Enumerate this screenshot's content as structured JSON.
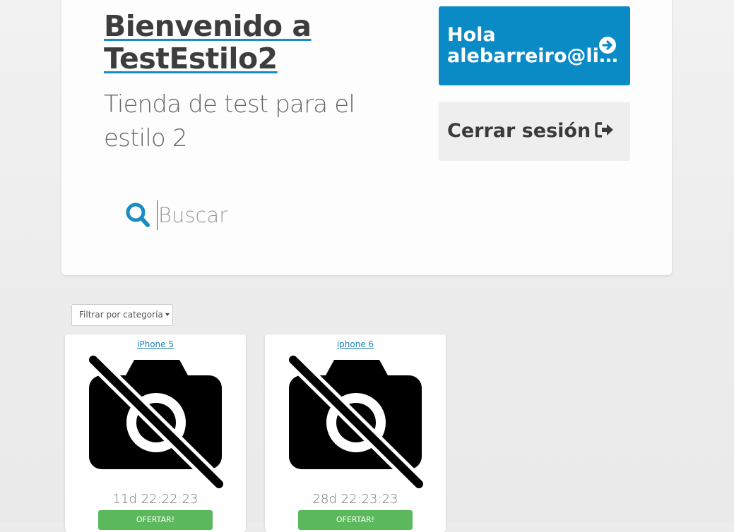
{
  "header": {
    "title": "Bienvenido a TestEstilo2",
    "subtitle": "Tienda de test para el estilo 2",
    "user_button": {
      "greeting": "Hola",
      "user": "alebarreiro@li..."
    },
    "logout_label": "Cerrar sesión"
  },
  "search": {
    "placeholder": "Buscar"
  },
  "filter": {
    "label": "Filtrar por categoría"
  },
  "products": [
    {
      "name": "iPhone 5",
      "timer": "11d 22:22:23",
      "offer_label": "OFERTAR!"
    },
    {
      "name": "iphone 6",
      "timer": "28d 22:23:23",
      "offer_label": "OFERTAR!"
    }
  ],
  "colors": {
    "accent": "#0a8bc6",
    "offer": "#5cb85c"
  },
  "icons": [
    "search-icon",
    "arrow-circle-right-icon",
    "sign-out-icon",
    "no-camera-icon",
    "caret-down-icon"
  ]
}
